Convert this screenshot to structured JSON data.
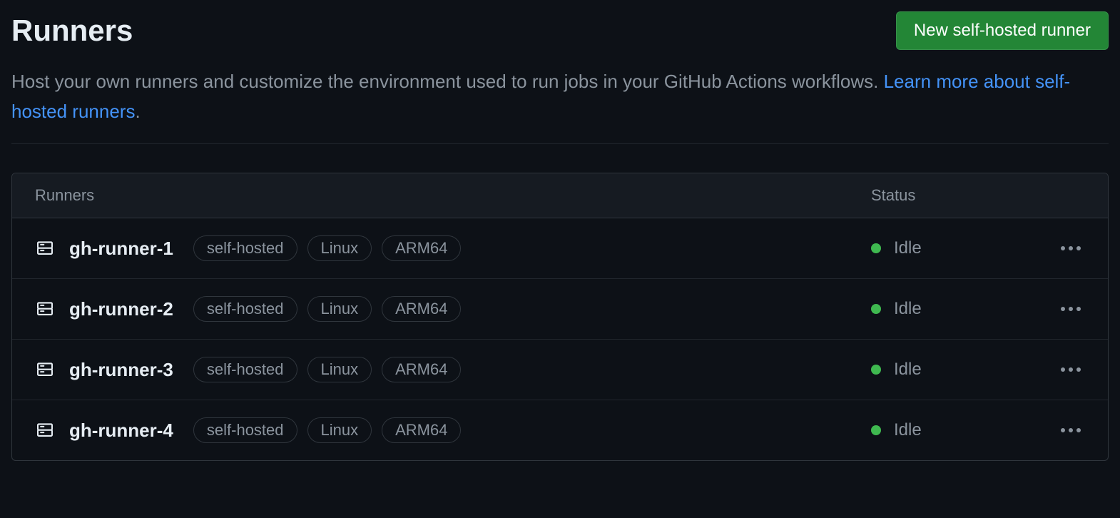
{
  "header": {
    "title": "Runners",
    "new_button_label": "New self-hosted runner"
  },
  "description": {
    "text": "Host your own runners and customize the environment used to run jobs in your GitHub Actions workflows. ",
    "link_text": "Learn more about self-hosted runners",
    "period": "."
  },
  "table": {
    "columns": {
      "runners": "Runners",
      "status": "Status"
    },
    "rows": [
      {
        "name": "gh-runner-1",
        "labels": [
          "self-hosted",
          "Linux",
          "ARM64"
        ],
        "status": "Idle",
        "status_color": "#3fb950"
      },
      {
        "name": "gh-runner-2",
        "labels": [
          "self-hosted",
          "Linux",
          "ARM64"
        ],
        "status": "Idle",
        "status_color": "#3fb950"
      },
      {
        "name": "gh-runner-3",
        "labels": [
          "self-hosted",
          "Linux",
          "ARM64"
        ],
        "status": "Idle",
        "status_color": "#3fb950"
      },
      {
        "name": "gh-runner-4",
        "labels": [
          "self-hosted",
          "Linux",
          "ARM64"
        ],
        "status": "Idle",
        "status_color": "#3fb950"
      }
    ]
  }
}
